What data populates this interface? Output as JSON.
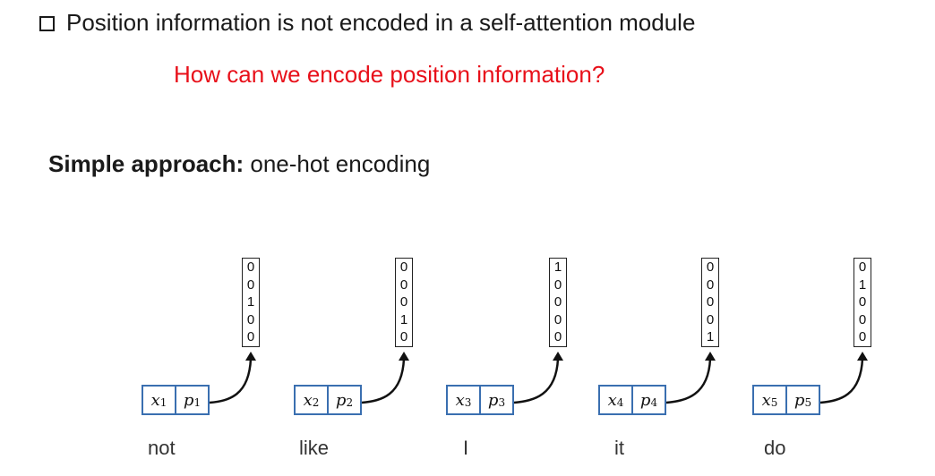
{
  "slide": {
    "bullet": "Position information is not encoded in a self-attention module",
    "question": "How can we encode position information?",
    "approach_bold": "Simple approach:",
    "approach_rest": " one-hot encoding"
  },
  "colors": {
    "question": "#e8101a",
    "token_border": "#3a6fb0"
  },
  "tokens": [
    {
      "word": "not",
      "x": "x",
      "p": "p",
      "index": "1",
      "vector": [
        "0",
        "0",
        "1",
        "0",
        "0"
      ]
    },
    {
      "word": "like",
      "x": "x",
      "p": "p",
      "index": "2",
      "vector": [
        "0",
        "0",
        "0",
        "1",
        "0"
      ]
    },
    {
      "word": "I",
      "x": "x",
      "p": "p",
      "index": "3",
      "vector": [
        "1",
        "0",
        "0",
        "0",
        "0"
      ]
    },
    {
      "word": "it",
      "x": "x",
      "p": "p",
      "index": "4",
      "vector": [
        "0",
        "0",
        "0",
        "0",
        "1"
      ]
    },
    {
      "word": "do",
      "x": "x",
      "p": "p",
      "index": "5",
      "vector": [
        "0",
        "1",
        "0",
        "0",
        "0"
      ]
    }
  ]
}
